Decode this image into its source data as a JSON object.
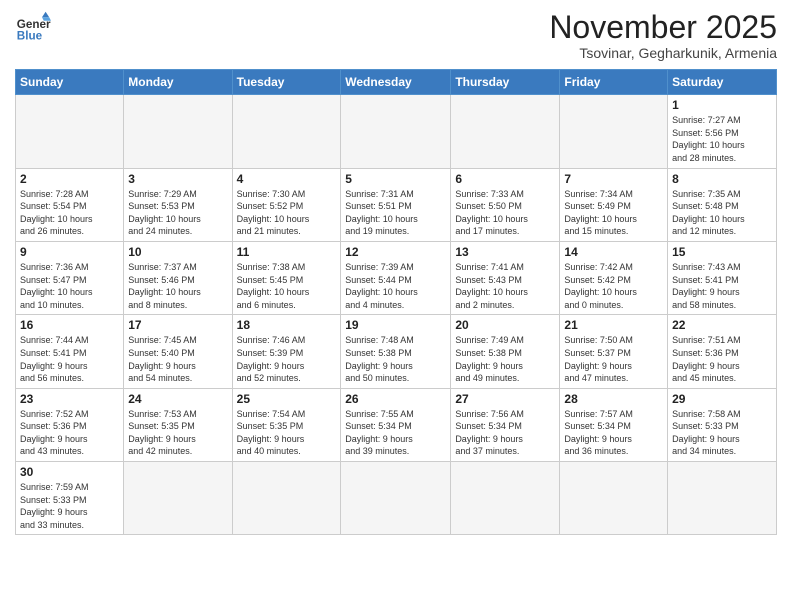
{
  "logo": {
    "line1": "General",
    "line2": "Blue"
  },
  "header": {
    "month": "November 2025",
    "location": "Tsovinar, Gegharkunik, Armenia"
  },
  "weekdays": [
    "Sunday",
    "Monday",
    "Tuesday",
    "Wednesday",
    "Thursday",
    "Friday",
    "Saturday"
  ],
  "weeks": [
    [
      {
        "day": "",
        "info": ""
      },
      {
        "day": "",
        "info": ""
      },
      {
        "day": "",
        "info": ""
      },
      {
        "day": "",
        "info": ""
      },
      {
        "day": "",
        "info": ""
      },
      {
        "day": "",
        "info": ""
      },
      {
        "day": "1",
        "info": "Sunrise: 7:27 AM\nSunset: 5:56 PM\nDaylight: 10 hours\nand 28 minutes."
      }
    ],
    [
      {
        "day": "2",
        "info": "Sunrise: 7:28 AM\nSunset: 5:54 PM\nDaylight: 10 hours\nand 26 minutes."
      },
      {
        "day": "3",
        "info": "Sunrise: 7:29 AM\nSunset: 5:53 PM\nDaylight: 10 hours\nand 24 minutes."
      },
      {
        "day": "4",
        "info": "Sunrise: 7:30 AM\nSunset: 5:52 PM\nDaylight: 10 hours\nand 21 minutes."
      },
      {
        "day": "5",
        "info": "Sunrise: 7:31 AM\nSunset: 5:51 PM\nDaylight: 10 hours\nand 19 minutes."
      },
      {
        "day": "6",
        "info": "Sunrise: 7:33 AM\nSunset: 5:50 PM\nDaylight: 10 hours\nand 17 minutes."
      },
      {
        "day": "7",
        "info": "Sunrise: 7:34 AM\nSunset: 5:49 PM\nDaylight: 10 hours\nand 15 minutes."
      },
      {
        "day": "8",
        "info": "Sunrise: 7:35 AM\nSunset: 5:48 PM\nDaylight: 10 hours\nand 12 minutes."
      }
    ],
    [
      {
        "day": "9",
        "info": "Sunrise: 7:36 AM\nSunset: 5:47 PM\nDaylight: 10 hours\nand 10 minutes."
      },
      {
        "day": "10",
        "info": "Sunrise: 7:37 AM\nSunset: 5:46 PM\nDaylight: 10 hours\nand 8 minutes."
      },
      {
        "day": "11",
        "info": "Sunrise: 7:38 AM\nSunset: 5:45 PM\nDaylight: 10 hours\nand 6 minutes."
      },
      {
        "day": "12",
        "info": "Sunrise: 7:39 AM\nSunset: 5:44 PM\nDaylight: 10 hours\nand 4 minutes."
      },
      {
        "day": "13",
        "info": "Sunrise: 7:41 AM\nSunset: 5:43 PM\nDaylight: 10 hours\nand 2 minutes."
      },
      {
        "day": "14",
        "info": "Sunrise: 7:42 AM\nSunset: 5:42 PM\nDaylight: 10 hours\nand 0 minutes."
      },
      {
        "day": "15",
        "info": "Sunrise: 7:43 AM\nSunset: 5:41 PM\nDaylight: 9 hours\nand 58 minutes."
      }
    ],
    [
      {
        "day": "16",
        "info": "Sunrise: 7:44 AM\nSunset: 5:41 PM\nDaylight: 9 hours\nand 56 minutes."
      },
      {
        "day": "17",
        "info": "Sunrise: 7:45 AM\nSunset: 5:40 PM\nDaylight: 9 hours\nand 54 minutes."
      },
      {
        "day": "18",
        "info": "Sunrise: 7:46 AM\nSunset: 5:39 PM\nDaylight: 9 hours\nand 52 minutes."
      },
      {
        "day": "19",
        "info": "Sunrise: 7:48 AM\nSunset: 5:38 PM\nDaylight: 9 hours\nand 50 minutes."
      },
      {
        "day": "20",
        "info": "Sunrise: 7:49 AM\nSunset: 5:38 PM\nDaylight: 9 hours\nand 49 minutes."
      },
      {
        "day": "21",
        "info": "Sunrise: 7:50 AM\nSunset: 5:37 PM\nDaylight: 9 hours\nand 47 minutes."
      },
      {
        "day": "22",
        "info": "Sunrise: 7:51 AM\nSunset: 5:36 PM\nDaylight: 9 hours\nand 45 minutes."
      }
    ],
    [
      {
        "day": "23",
        "info": "Sunrise: 7:52 AM\nSunset: 5:36 PM\nDaylight: 9 hours\nand 43 minutes."
      },
      {
        "day": "24",
        "info": "Sunrise: 7:53 AM\nSunset: 5:35 PM\nDaylight: 9 hours\nand 42 minutes."
      },
      {
        "day": "25",
        "info": "Sunrise: 7:54 AM\nSunset: 5:35 PM\nDaylight: 9 hours\nand 40 minutes."
      },
      {
        "day": "26",
        "info": "Sunrise: 7:55 AM\nSunset: 5:34 PM\nDaylight: 9 hours\nand 39 minutes."
      },
      {
        "day": "27",
        "info": "Sunrise: 7:56 AM\nSunset: 5:34 PM\nDaylight: 9 hours\nand 37 minutes."
      },
      {
        "day": "28",
        "info": "Sunrise: 7:57 AM\nSunset: 5:34 PM\nDaylight: 9 hours\nand 36 minutes."
      },
      {
        "day": "29",
        "info": "Sunrise: 7:58 AM\nSunset: 5:33 PM\nDaylight: 9 hours\nand 34 minutes."
      }
    ],
    [
      {
        "day": "30",
        "info": "Sunrise: 7:59 AM\nSunset: 5:33 PM\nDaylight: 9 hours\nand 33 minutes."
      },
      {
        "day": "",
        "info": ""
      },
      {
        "day": "",
        "info": ""
      },
      {
        "day": "",
        "info": ""
      },
      {
        "day": "",
        "info": ""
      },
      {
        "day": "",
        "info": ""
      },
      {
        "day": "",
        "info": ""
      }
    ]
  ]
}
